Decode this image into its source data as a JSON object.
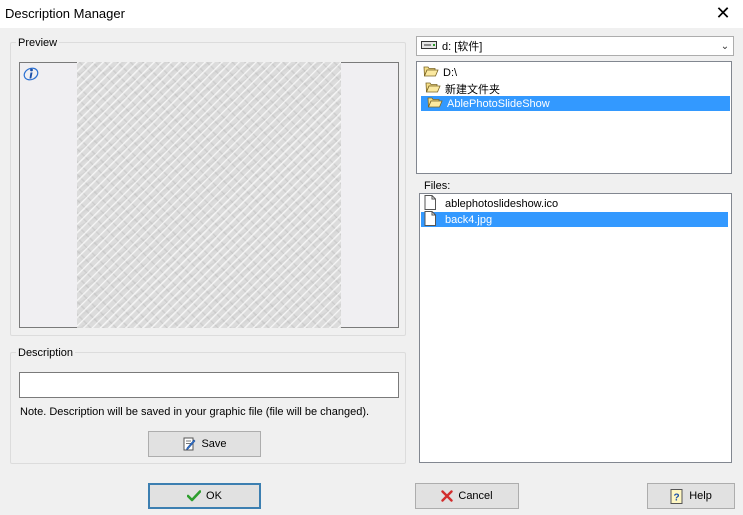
{
  "window": {
    "title": "Description Manager",
    "close_glyph": "✕"
  },
  "preview": {
    "label": "Preview",
    "info_icon": "info-icon"
  },
  "description": {
    "label": "Description",
    "value": "",
    "placeholder": "",
    "note": "Note. Description will be saved in your graphic file (file will be changed).",
    "save_label": "Save"
  },
  "drive": {
    "value": "d: [软件]",
    "icon": "drive-icon"
  },
  "folders": [
    {
      "label": "D:\\",
      "icon": "open-folder-icon",
      "selected": false
    },
    {
      "label": "新建文件夹",
      "icon": "open-folder-icon",
      "selected": false
    },
    {
      "label": "AblePhotoSlideShow",
      "icon": "open-folder-icon",
      "selected": true
    }
  ],
  "files": {
    "label": "Files:",
    "items": [
      {
        "name": "ablephotoslideshow.ico",
        "selected": false
      },
      {
        "name": "back4.jpg",
        "selected": true
      }
    ]
  },
  "buttons": {
    "ok": "OK",
    "cancel": "Cancel",
    "help": "Help"
  },
  "colors": {
    "selection": "#3399ff",
    "default_button_border": "#3c7fb1",
    "ok_check": "#2e9e2e",
    "cancel_x": "#d22d2d"
  }
}
